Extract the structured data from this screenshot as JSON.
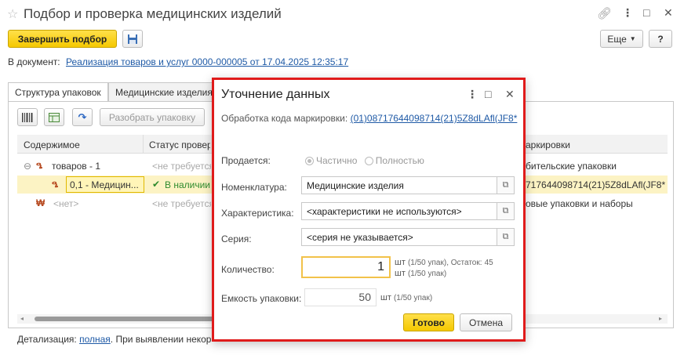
{
  "window": {
    "title": "Подбор и проверка медицинских изделий",
    "controls": [
      "link-icon",
      "more-icon",
      "maximize-icon",
      "close-icon"
    ]
  },
  "toolbar": {
    "finish_label": "Завершить подбор",
    "more_label": "Еще",
    "help_label": "?"
  },
  "document": {
    "label": "В документ:",
    "link": "Реализация товаров и услуг 0000-000005 от 17.04.2025 12:35:17"
  },
  "tabs": [
    {
      "label": "Структура упаковок"
    },
    {
      "label": "Медицинские изделия"
    }
  ],
  "panel_toolbar": {
    "unpack_label": "Разобрать упаковку"
  },
  "grid": {
    "columns": [
      "Содержимое",
      "Статус проверки",
      "аркировки"
    ],
    "rows": [
      {
        "content": "товаров - 1",
        "status": "<не требуется>",
        "code": "бительские упаковки"
      },
      {
        "content": "0,1 - Медицин...",
        "status": "В наличии",
        "code": "717644098714(21)5Z8dLAfl(JF8*"
      },
      {
        "content": "<нет>",
        "status": "<не требуется>",
        "code": "овые упаковки и наборы"
      }
    ]
  },
  "footer": {
    "detail_label": "Детализация:",
    "detail_link": "полная",
    "detail_rest": ". При выявлении некорр"
  },
  "dialog": {
    "title": "Уточнение данных",
    "subtitle_label": "Обработка кода маркировки:",
    "subtitle_link": "(01)08717644098714(21)5Z8dLAfl(JF8*",
    "sold_label": "Продается:",
    "sold_option_partial": "Частично",
    "sold_option_full": "Полностью",
    "nomenclature_label": "Номенклатура:",
    "nomenclature_value": "Медицинские изделия",
    "characteristic_label": "Характеристика:",
    "characteristic_value": "<характеристики не используются>",
    "series_label": "Серия:",
    "series_value": "<серия не указывается>",
    "quantity_label": "Количество:",
    "quantity_value": "1",
    "quantity_unit_1": "шт",
    "quantity_unit_1b": "(1/50 упак), Остаток:",
    "quantity_remain": "45",
    "quantity_unit_2": "шт",
    "quantity_unit_2b": "(1/50 упак)",
    "capacity_label": "Емкость упаковки:",
    "capacity_value": "50",
    "capacity_unit": "шт",
    "capacity_unit_b": "(1/50 упак)",
    "ok_label": "Готово",
    "cancel_label": "Отмена"
  }
}
